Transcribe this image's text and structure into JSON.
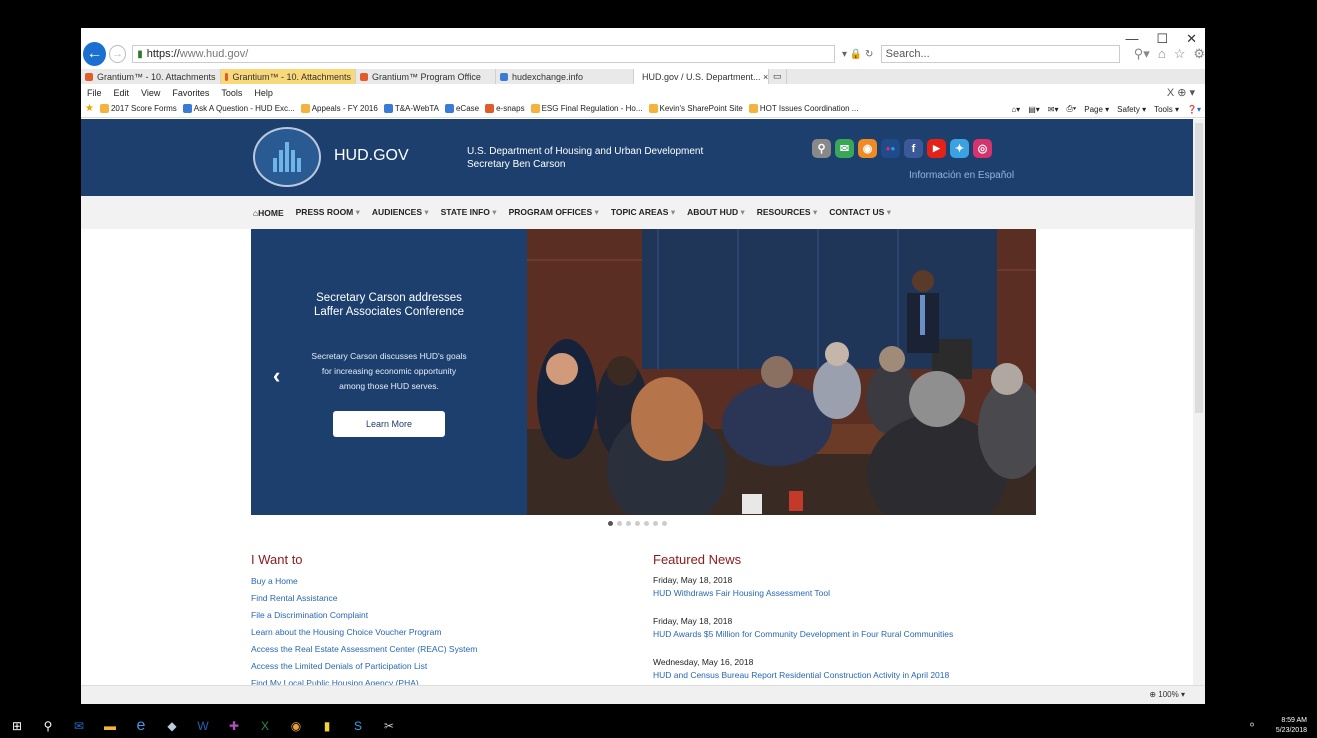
{
  "browser": {
    "url_protocol": "https://",
    "url_host": "www.hud.gov/",
    "search_placeholder": "Search...",
    "tabs": [
      {
        "label": "Grantium™ - 10. Attachments",
        "style": "normal"
      },
      {
        "label": "Grantium™ - 10. Attachments",
        "style": "active-orange"
      },
      {
        "label": "Grantium™ Program Office",
        "style": "normal"
      },
      {
        "label": "hudexchange.info",
        "style": "normal"
      },
      {
        "label": "HUD.gov / U.S. Department... ×",
        "style": "current"
      }
    ],
    "menu": [
      "File",
      "Edit",
      "View",
      "Favorites",
      "Tools",
      "Help"
    ],
    "favorites": [
      "2017 Score Forms",
      "Ask A Question - HUD Exc...",
      "Appeals - FY 2016",
      "T&A-WebTA",
      "eCase",
      "e-snaps",
      "ESG Final Regulation - Ho...",
      "Kevin's SharePoint Site",
      "HOT Issues Coordination ..."
    ],
    "command_bar": [
      "Page ▾",
      "Safety ▾",
      "Tools ▾"
    ],
    "zoom": "100%"
  },
  "site": {
    "title": "HUD.GOV",
    "dept_line1": "U.S. Department of Housing and Urban Development",
    "dept_line2": "Secretary Ben Carson",
    "espanol": "Información en Español",
    "socials": [
      {
        "name": "search-icon",
        "glyph": "⚲",
        "color": "#888888"
      },
      {
        "name": "email-icon",
        "glyph": "✉",
        "color": "#3aa657"
      },
      {
        "name": "rss-icon",
        "glyph": "◉",
        "color": "#f08a24"
      },
      {
        "name": "flickr-icon",
        "glyph": "●●",
        "color": "#1e4b8a"
      },
      {
        "name": "facebook-icon",
        "glyph": "f",
        "color": "#3b5998"
      },
      {
        "name": "youtube-icon",
        "glyph": "▶",
        "color": "#e62117"
      },
      {
        "name": "twitter-icon",
        "glyph": "✦",
        "color": "#3aa2e0"
      },
      {
        "name": "instagram-icon",
        "glyph": "◎",
        "color": "#d6336c"
      }
    ],
    "nav": [
      {
        "label": "HOME",
        "caret": ""
      },
      {
        "label": "PRESS ROOM",
        "caret": "▾"
      },
      {
        "label": "AUDIENCES",
        "caret": "▾"
      },
      {
        "label": "STATE INFO",
        "caret": "▾"
      },
      {
        "label": "PROGRAM OFFICES",
        "caret": "▾"
      },
      {
        "label": "TOPIC AREAS",
        "caret": "▾"
      },
      {
        "label": "ABOUT HUD",
        "caret": "▾"
      },
      {
        "label": "RESOURCES",
        "caret": "▾"
      },
      {
        "label": "CONTACT US",
        "caret": "▾"
      }
    ],
    "hero": {
      "title_line1": "Secretary Carson addresses",
      "title_line2": "Laffer Associates Conference",
      "desc_line1": "Secretary Carson discusses HUD's goals",
      "desc_line2": "for increasing economic opportunity",
      "desc_line3": "among those HUD serves.",
      "button": "Learn More",
      "slide_index": 1,
      "slide_count": 7
    },
    "iwant": {
      "heading": "I Want to",
      "links": [
        "Buy a Home",
        "Find Rental Assistance",
        "File a Discrimination Complaint",
        "Learn about the Housing Choice Voucher Program",
        "Access the Real Estate Assessment Center (REAC) System",
        "Access the Limited Denials of Participation List",
        "Find My Local Public Housing Agency (PHA)"
      ]
    },
    "news": {
      "heading": "Featured News",
      "items": [
        {
          "date": "Friday, May 18, 2018",
          "title": "HUD Withdraws Fair Housing Assessment Tool"
        },
        {
          "date": "Friday, May 18, 2018",
          "title": "HUD Awards $5 Million for Community Development in Four Rural Communities"
        },
        {
          "date": "Wednesday, May 16, 2018",
          "title": "HUD and Census Bureau Report Residential Construction Activity in April 2018"
        }
      ]
    }
  },
  "taskbar": {
    "time": "8:59 AM",
    "date": "5/23/2018"
  }
}
